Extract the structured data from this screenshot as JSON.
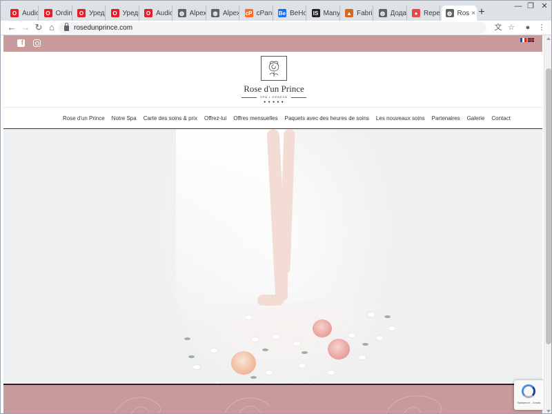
{
  "browser": {
    "tabs": [
      {
        "label": "Audio E",
        "icon": "opera-icon",
        "color": "#e31e2b"
      },
      {
        "label": "Ordina",
        "icon": "opera-icon",
        "color": "#e31e2b"
      },
      {
        "label": "Уреди",
        "icon": "opera-icon",
        "color": "#e31e2b"
      },
      {
        "label": "Уреди",
        "icon": "opera-icon",
        "color": "#e31e2b"
      },
      {
        "label": "Audio E",
        "icon": "opera-icon",
        "color": "#e31e2b"
      },
      {
        "label": "AlpexFe",
        "icon": "globe-icon",
        "color": "#5f6368"
      },
      {
        "label": "AlpexFe",
        "icon": "globe-icon",
        "color": "#5f6368"
      },
      {
        "label": "cPanel",
        "icon": "cpanel-icon",
        "color": "#ff6c2c"
      },
      {
        "label": "BeHome",
        "icon": "behance-icon",
        "color": "#1769ff"
      },
      {
        "label": "Many P",
        "icon": "is-icon",
        "color": "#222222"
      },
      {
        "label": "Fabriko",
        "icon": "fabriko-icon",
        "color": "#d2691e"
      },
      {
        "label": "Додаш",
        "icon": "globe-icon",
        "color": "#5f6368"
      },
      {
        "label": "Reperto",
        "icon": "reperto-icon",
        "color": "#e54b4b"
      },
      {
        "label": "Ros",
        "icon": "globe-icon",
        "color": "#5f6368"
      }
    ],
    "new_tab": "+",
    "window_controls": {
      "minimize": "—",
      "restore": "❐",
      "close": "✕"
    },
    "url": "rosedunprince.com",
    "nav": {
      "back": "←",
      "forward": "→",
      "reload": "↻",
      "home": "⌂"
    },
    "toolbar_icons": {
      "translate": "⽂",
      "bookmark": "☆",
      "profile": "●",
      "menu": "⋮"
    }
  },
  "site": {
    "brand_name": "Rose d'un Prince",
    "tagline": "SPA • GENEVA",
    "stars": "● ● ● ● ●",
    "social": {
      "facebook": "f"
    },
    "nav_items": [
      "Rose d'un Prince",
      "Notre Spa",
      "Carte des soins & prix",
      "Offrez-lui",
      "Offres mensuelles",
      "Paquets avec des heures de soins",
      "Les nouveaux soins",
      "Partenaires",
      "Galerie",
      "Contact"
    ],
    "recaptcha_text": "Приватност - Услови",
    "colors": {
      "accent": "#c79a9b",
      "text": "#333333"
    }
  }
}
